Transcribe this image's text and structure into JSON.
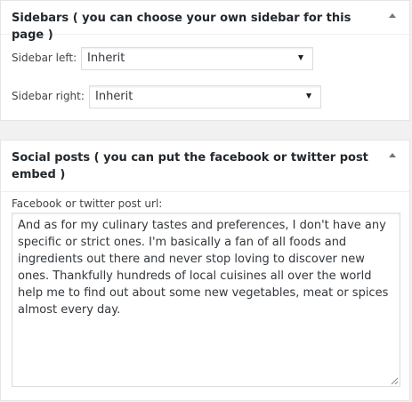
{
  "sidebars": {
    "title": "Sidebars ( you can choose your own sidebar for this page )",
    "left_label": "Sidebar left:",
    "left_value": "Inherit",
    "right_label": "Sidebar right:",
    "right_value": "Inherit"
  },
  "social": {
    "title": "Social posts ( you can put the facebook or twitter post embed )",
    "url_label": "Facebook or twitter post url:",
    "url_value": "And as for my culinary tastes and preferences, I don't have any specific or strict ones. I'm basically a fan of all foods and ingredients out there and never stop loving to discover new ones. Thankfully hundreds of local cuisines all over the world help me to find out about some new vegetables, meat or spices almost every day."
  },
  "icons": {
    "collapse": "triangle-up-icon",
    "dropdown": "chevron-down-icon",
    "resize": "resize-grip-icon"
  }
}
